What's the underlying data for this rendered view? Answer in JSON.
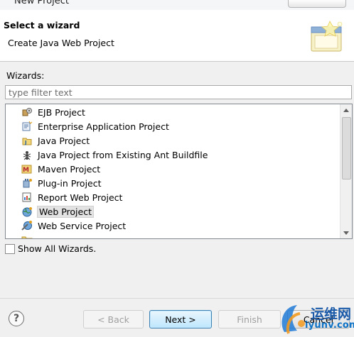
{
  "window": {
    "title": "New Project"
  },
  "header": {
    "heading": "Select a wizard",
    "description": "Create Java Web Project"
  },
  "wizards": {
    "label": "Wizards:",
    "filter_placeholder": "type filter text",
    "items": [
      {
        "label": "EJB Project",
        "icon": "ejb-project-icon"
      },
      {
        "label": "Enterprise Application Project",
        "icon": "enterprise-app-icon"
      },
      {
        "label": "Java Project",
        "icon": "java-project-icon"
      },
      {
        "label": "Java Project from Existing Ant Buildfile",
        "icon": "ant-icon"
      },
      {
        "label": "Maven Project",
        "icon": "maven-icon"
      },
      {
        "label": "Plug-in Project",
        "icon": "plugin-icon"
      },
      {
        "label": "Report Web Project",
        "icon": "report-icon"
      },
      {
        "label": "Web Project",
        "icon": "web-project-icon",
        "selected": true
      },
      {
        "label": "Web Service Project",
        "icon": "web-service-icon"
      }
    ]
  },
  "show_all": {
    "label": "Show All Wizards.",
    "checked": false
  },
  "buttons": {
    "back": "< Back",
    "next": "Next >",
    "finish": "Finish",
    "cancel": "Cancel"
  },
  "watermark": {
    "line1": "运维网",
    "line2": "iyunv.com"
  }
}
